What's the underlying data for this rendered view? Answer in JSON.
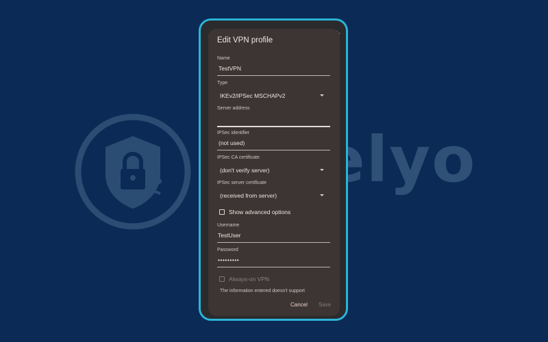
{
  "watermark": {
    "brand": "Safelyo"
  },
  "phone": {
    "top_left_icon": "back-arrow-icon",
    "top_right_icon": "plus-icon"
  },
  "dialog": {
    "title": "Edit VPN profile",
    "name": {
      "label": "Name",
      "value": "TestVPN"
    },
    "type": {
      "label": "Type",
      "value": "IKEv2/IPSec MSCHAPv2"
    },
    "server_address": {
      "label": "Server address",
      "value": ""
    },
    "ipsec_identifier": {
      "label": "IPSec identifier",
      "value": "(not used)"
    },
    "ipsec_ca_certificate": {
      "label": "IPSec CA certificate",
      "value": "(don't verify server)"
    },
    "ipsec_server_certificate": {
      "label": "IPSec server certificate",
      "value": "(received from server)"
    },
    "advanced": {
      "label": "Show advanced options",
      "checked": false
    },
    "username": {
      "label": "Username",
      "value": "TestUser"
    },
    "password": {
      "label": "Password",
      "value": "•••••••••"
    },
    "always_on": {
      "label": "Always-on VPN",
      "checked": false,
      "disabled": true
    },
    "info_text": "The information entered doesn't support",
    "cancel_label": "Cancel",
    "save_label": "Save"
  },
  "colors": {
    "background": "#0b2a55",
    "phone_border": "#2ab5d6",
    "dialog_bg": "#3c3533",
    "accent": "#f1d0c6"
  }
}
